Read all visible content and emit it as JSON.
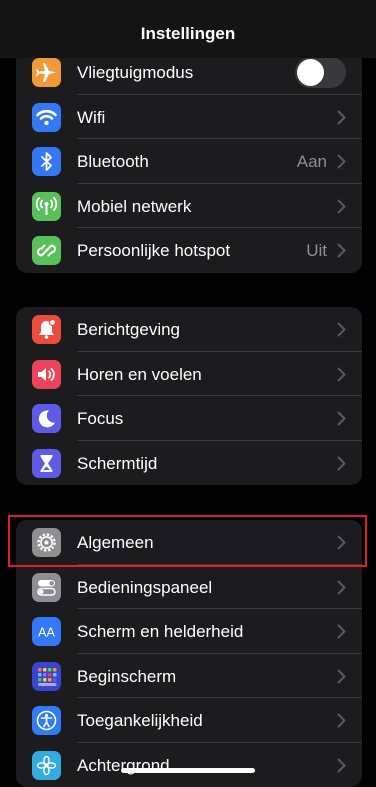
{
  "nav": {
    "title": "Instellingen"
  },
  "group1": [
    {
      "label": "Vliegtuigmodus",
      "icon": "airplane-icon",
      "color": "#f09a37",
      "control": "toggle",
      "toggle_on": false
    },
    {
      "label": "Wifi",
      "icon": "wifi-icon",
      "color": "#3478f6",
      "control": "chevron",
      "value": ""
    },
    {
      "label": "Bluetooth",
      "icon": "bluetooth-icon",
      "color": "#3478f6",
      "control": "chevron",
      "value": "Aan"
    },
    {
      "label": "Mobiel netwerk",
      "icon": "antenna-icon",
      "color": "#5ac05a",
      "control": "chevron",
      "value": ""
    },
    {
      "label": "Persoonlijke hotspot",
      "icon": "hotspot-icon",
      "color": "#5ac05a",
      "control": "chevron",
      "value": "Uit"
    }
  ],
  "group2": [
    {
      "label": "Berichtgeving",
      "icon": "notification-bell-icon",
      "color": "#eb4d3d"
    },
    {
      "label": "Horen en voelen",
      "icon": "speaker-icon",
      "color": "#eb445a"
    },
    {
      "label": "Focus",
      "icon": "moon-icon",
      "color": "#5e5ce6"
    },
    {
      "label": "Schermtijd",
      "icon": "hourglass-icon",
      "color": "#5e5ce6"
    }
  ],
  "group3": [
    {
      "label": "Algemeen",
      "icon": "gear-icon",
      "color": "#8e8e93"
    },
    {
      "label": "Bedieningspaneel",
      "icon": "switches-icon",
      "color": "#8e8e93"
    },
    {
      "label": "Scherm en helderheid",
      "icon": "text-size-icon",
      "color": "#3478f6",
      "icon_text": "AA"
    },
    {
      "label": "Beginscherm",
      "icon": "home-grid-icon",
      "color": "#3a46d0"
    },
    {
      "label": "Toegankelijkheid",
      "icon": "accessibility-icon",
      "color": "#2f7cf6"
    },
    {
      "label": "Achtergrond",
      "icon": "wallpaper-flower-icon",
      "color": "#35aadc"
    }
  ],
  "highlight_color": "#e01e26"
}
